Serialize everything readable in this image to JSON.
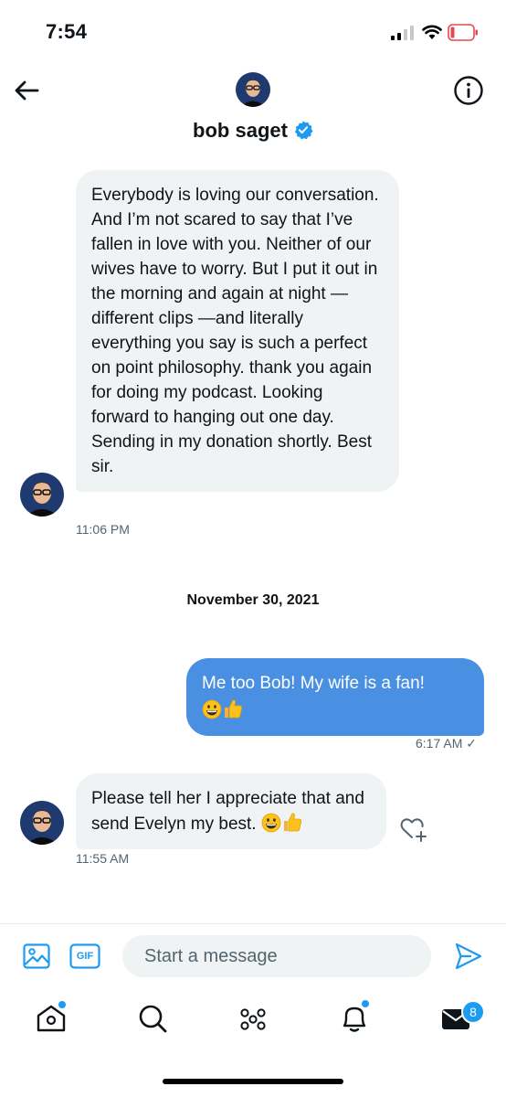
{
  "status_bar": {
    "time": "7:54"
  },
  "header": {
    "name": "bob saget"
  },
  "messages": [
    {
      "text": "Everybody is loving our conversation. And I’m not scared to say that I’ve fallen in love with you. Neither of our wives have to worry. But I put it out in the morning and again at night — different clips —and literally everything you say is such a perfect on point philosophy. thank you again for doing my podcast. Looking forward to hanging out one day. Sending in my donation shortly. Best sir.",
      "time": "11:06 PM"
    },
    {
      "text": "Me too Bob!  My wife is a fan!",
      "time": "6:17 AM ✓"
    },
    {
      "text": "Please tell her I appreciate that and send Evelyn my best.",
      "time": "11:55 AM"
    }
  ],
  "date_separator": "November 30, 2021",
  "composer": {
    "placeholder": "Start a message",
    "gif_label": "GIF"
  },
  "tabbar": {
    "messages_badge": "8"
  },
  "colors": {
    "accent": "#1d9bf0",
    "outgoing_bubble": "#4a90e2",
    "incoming_bubble": "#eff3f4"
  }
}
